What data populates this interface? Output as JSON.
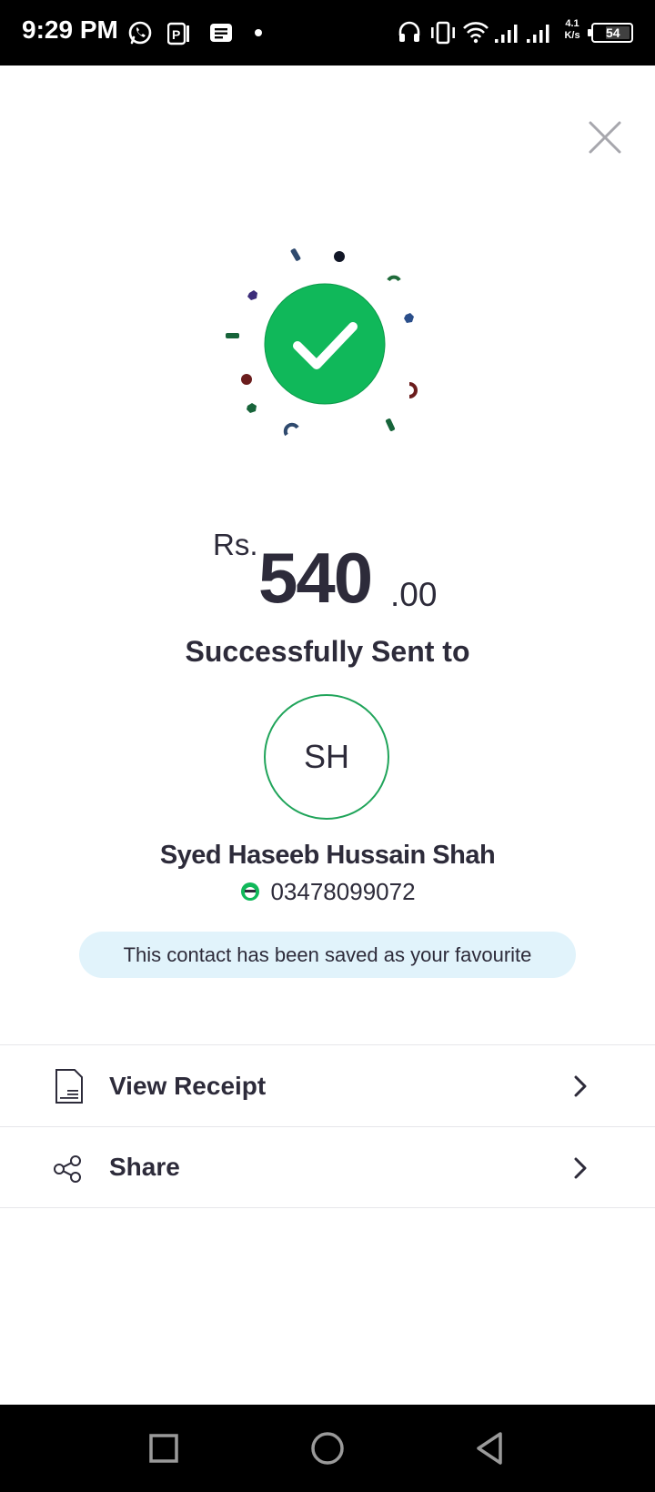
{
  "status_bar": {
    "time": "9:29 PM",
    "net_speed_value": "4.1",
    "net_speed_unit": "K/s",
    "battery": "54",
    "icons": [
      "whatsapp-icon",
      "parking-app-icon",
      "message-icon",
      "dot-icon",
      "headset-icon",
      "vibrate-icon",
      "wifi-icon",
      "signal-icon",
      "signal-icon-2",
      "battery-icon"
    ]
  },
  "close_icon": "close-icon",
  "transaction": {
    "currency": "Rs.",
    "amount_whole": "540",
    "amount_decimal": ".00",
    "status_text": "Successfully Sent to"
  },
  "recipient": {
    "initials": "SH",
    "name": "Syed Haseeb Hussain Shah",
    "phone": "03478099072",
    "network_icon": "easypaisa-logo-icon"
  },
  "favourite_banner": "This contact has been saved as your favourite",
  "actions": [
    {
      "label": "View Receipt",
      "icon": "receipt-icon"
    },
    {
      "label": "Share",
      "icon": "share-icon"
    }
  ],
  "colors": {
    "success_green": "#10b85a",
    "avatar_border": "#20a45a",
    "banner_bg": "#e1f3fb",
    "text": "#2d2b3a"
  },
  "nav_bar": [
    "recents-button",
    "home-button",
    "back-button"
  ]
}
